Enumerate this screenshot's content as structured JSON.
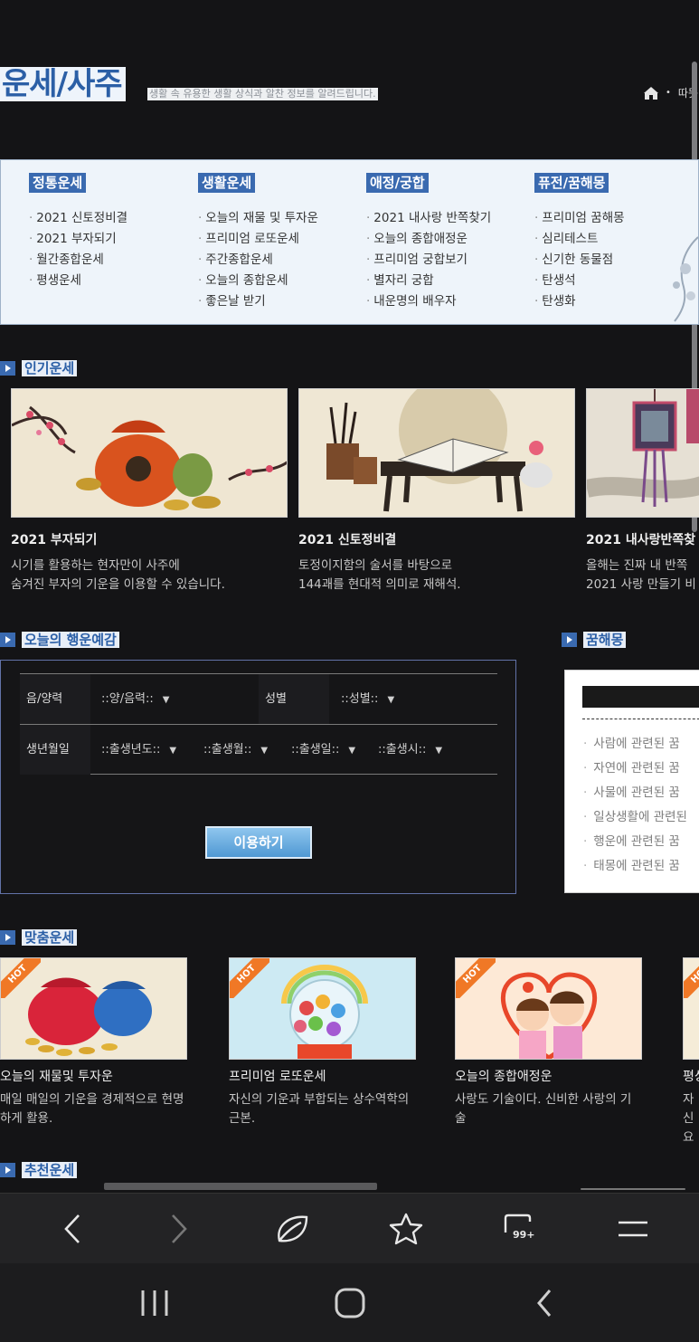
{
  "header": {
    "title": "운세/사주",
    "subtitle": "생활 속 유용한 생활 상식과 알찬 정보를 알려드립니다.",
    "breadcrumb_sep": "•",
    "breadcrumb_text": "따뜻"
  },
  "menu": {
    "columns": [
      {
        "heading": "정통운세",
        "items": [
          "2021 신토정비결",
          "2021 부자되기",
          "월간종합운세",
          "평생운세"
        ]
      },
      {
        "heading": "생활운세",
        "items": [
          "오늘의 재물 및 투자운",
          "프리미엄 로또운세",
          "주간종합운세",
          "오늘의 종합운세",
          "좋은날 받기"
        ]
      },
      {
        "heading": "애정/궁합",
        "items": [
          "2021 내사랑 반쪽찾기",
          "오늘의 종합애정운",
          "프리미엄 궁합보기",
          "별자리 궁합",
          "내운명의 배우자"
        ]
      },
      {
        "heading": "퓨전/꿈해몽",
        "items": [
          "프리미엄 꿈해몽",
          "심리테스트",
          "신기한 동물점",
          "탄생석",
          "탄생화"
        ]
      }
    ]
  },
  "popular": {
    "title": "인기운세",
    "cards": [
      {
        "name": "2021 부자되기",
        "desc1": "시기를 활용하는 현자만이 사주에",
        "desc2": "숨겨진 부자의 기운을 이용할 수 있습니다."
      },
      {
        "name": "2021 신토정비결",
        "desc1": "토정이지함의 술서를 바탕으로",
        "desc2": "144괘를 현대적 의미로 재해석."
      },
      {
        "name": "2021 내사랑반쪽찾",
        "desc1": "올해는 진짜 내 반쪽",
        "desc2": "2021 사랑 만들기 비"
      }
    ]
  },
  "today": {
    "title": "오늘의 행운예감",
    "calendar_label": "음/양력",
    "calendar_value": "::양/음력::",
    "gender_label": "성별",
    "gender_value": "::성별::",
    "birth_label": "생년월일",
    "year_value": "::출생년도::",
    "month_value": "::출생월::",
    "day_value": "::출생일::",
    "hour_value": "::출생시::",
    "caret": "▼",
    "submit": "이용하기"
  },
  "dream": {
    "title": "꿈해몽",
    "items": [
      "사람에 관련된 꿈",
      "자연에 관련된 꿈",
      "사물에 관련된 꿈",
      "일상생활에 관련된",
      "행운에 관련된 꿈",
      "태몽에 관련된 꿈"
    ]
  },
  "custom": {
    "title": "맞춤운세",
    "badge": "HOT",
    "cards": [
      {
        "name": "오늘의 재물및 투자운",
        "desc": "매일 매일의 기운을 경제적으로 현명하게 활용."
      },
      {
        "name": "프리미엄 로또운세",
        "desc": "자신의 기운과 부합되는 상수역학의 근본."
      },
      {
        "name": "오늘의 종합애정운",
        "desc": "사랑도 기술이다. 신비한 사랑의 기술"
      },
      {
        "name": "평상",
        "desc": "자신 요"
      }
    ]
  },
  "recommend": {
    "title": "추천운세"
  },
  "browser": {
    "tabs_count": "99+"
  },
  "colors": {
    "accent": "#3a6ab0",
    "background": "#141416",
    "badge": "#f07826"
  }
}
